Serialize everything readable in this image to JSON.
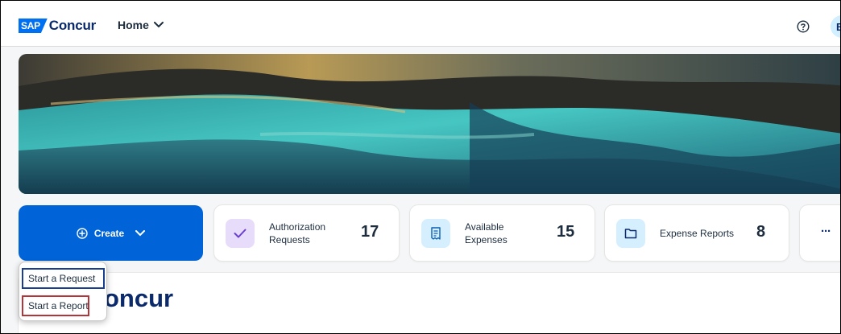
{
  "header": {
    "logo_badge": "SAP",
    "logo_word": "Concur",
    "home_menu_label": "Home",
    "avatar_initial": "B"
  },
  "create": {
    "label": "Create"
  },
  "tiles": [
    {
      "label_line1": "Authorization",
      "label_line2": "Requests",
      "count": "17",
      "icon": "checkmark-icon",
      "color": "#e8dcfb"
    },
    {
      "label_line1": "Available",
      "label_line2": "Expenses",
      "count": "15",
      "icon": "receipt-icon",
      "color": "#d6efff"
    },
    {
      "label_line1": "Expense Reports",
      "label_line2": "",
      "count": "8",
      "icon": "folder-icon",
      "color": "#d6efff"
    }
  ],
  "more_tile": {
    "label": "···"
  },
  "dropdown": {
    "items": [
      {
        "label": "Start a Request"
      },
      {
        "label": "Start a Report"
      }
    ]
  },
  "panel": {
    "title_visible": "oncur"
  },
  "colors": {
    "brand_blue": "#0064d9",
    "navy": "#0a2a6b",
    "highlight_red": "#b5343a"
  }
}
